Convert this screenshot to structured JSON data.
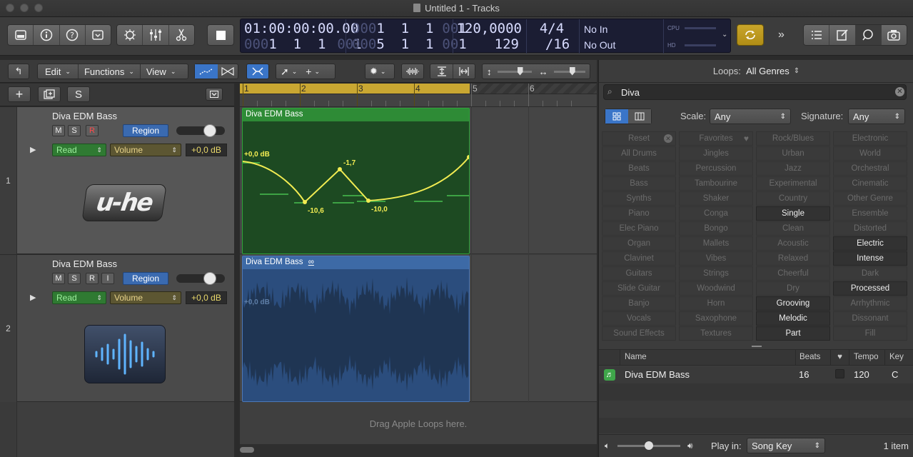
{
  "window": {
    "title": "Untitled 1 - Tracks"
  },
  "lcd": {
    "time": "01:00:00:00.00",
    "bars_top_dim": "000",
    "bars_top": "1  1  1",
    "ticks_top_dim": "00",
    "ticks_top": "1",
    "bars_bottom_dim": "000",
    "bars_bottom": "1  1  1",
    "ticks_bottom_dim": "00",
    "ticks_bottom": "1",
    "pos2_top_dim": "000",
    "pos2_top": "1  1  1",
    "pos2_top_tick_dim": "00",
    "pos2_top_tick": "1",
    "pos2_bottom_dim": "000",
    "pos2_bottom": "5  1  1",
    "pos2_bottom_tick_dim": "00",
    "pos2_bottom_tick": "1",
    "tempo": "120,0000",
    "tempo2": "129",
    "signature": "4/4",
    "division": "/16",
    "in": "No In",
    "out": "No Out",
    "cpu_label": "CPU",
    "hd_label": "HD"
  },
  "toolbar": {
    "edit": "Edit",
    "functions": "Functions",
    "view": "View",
    "add": "+",
    "solo": "S"
  },
  "tracks": [
    {
      "number": "1",
      "name": "Diva EDM Bass",
      "m": "M",
      "s": "S",
      "r": "R",
      "region": "Region",
      "read": "Read",
      "param": "Volume",
      "db": "+0,0 dB",
      "logo": "u-he"
    },
    {
      "number": "2",
      "name": "Diva EDM Bass",
      "m": "M",
      "s": "S",
      "r": "R",
      "i": "I",
      "region": "Region",
      "read": "Read",
      "param": "Volume",
      "db": "+0,0 dB"
    }
  ],
  "ruler": {
    "bars": [
      "1",
      "2",
      "3",
      "4",
      "5",
      "6"
    ]
  },
  "regions": [
    {
      "name": "Diva EDM Bass",
      "color": "#2d8a35"
    },
    {
      "name": "Diva EDM Bass",
      "loop_symbol": "∞",
      "color": "#3d5f93"
    }
  ],
  "automation": {
    "labels": [
      "+0,0 dB",
      "-1,7",
      "-10,6",
      "-10,0"
    ],
    "ghost_label": "+0,0 dB"
  },
  "drop_hint": "Drag Apple Loops here.",
  "loops": {
    "header_label": "Loops:",
    "header_value": "All Genres",
    "search_value": "Diva",
    "scale_label": "Scale:",
    "scale_value": "Any",
    "signature_label": "Signature:",
    "signature_value": "Any",
    "keywords": [
      [
        "Reset",
        "Favorites",
        "Rock/Blues",
        "Electronic"
      ],
      [
        "All Drums",
        "Jingles",
        "Urban",
        "World"
      ],
      [
        "Beats",
        "Percussion",
        "Jazz",
        "Orchestral"
      ],
      [
        "Bass",
        "Tambourine",
        "Experimental",
        "Cinematic"
      ],
      [
        "Synths",
        "Shaker",
        "Country",
        "Other Genre"
      ],
      [
        "Piano",
        "Conga",
        "Single",
        "Ensemble"
      ],
      [
        "Elec Piano",
        "Bongo",
        "Clean",
        "Distorted"
      ],
      [
        "Organ",
        "Mallets",
        "Acoustic",
        "Electric"
      ],
      [
        "Clavinet",
        "Vibes",
        "Relaxed",
        "Intense"
      ],
      [
        "Guitars",
        "Strings",
        "Cheerful",
        "Dark"
      ],
      [
        "Slide Guitar",
        "Woodwind",
        "Dry",
        "Processed"
      ],
      [
        "Banjo",
        "Horn",
        "Grooving",
        "Arrhythmic"
      ],
      [
        "Vocals",
        "Saxophone",
        "Melodic",
        "Dissonant"
      ],
      [
        "Sound Effects",
        "Textures",
        "Part",
        "Fill"
      ]
    ],
    "active_keywords": [
      "Single",
      "Electric",
      "Intense",
      "Processed",
      "Grooving",
      "Melodic",
      "Part"
    ],
    "columns": {
      "name": "Name",
      "beats": "Beats",
      "tempo": "Tempo",
      "key": "Key"
    },
    "results": [
      {
        "name": "Diva EDM Bass",
        "beats": "16",
        "tempo": "120",
        "key": "C"
      }
    ],
    "play_in_label": "Play in:",
    "play_in_value": "Song Key",
    "count": "1 item"
  }
}
